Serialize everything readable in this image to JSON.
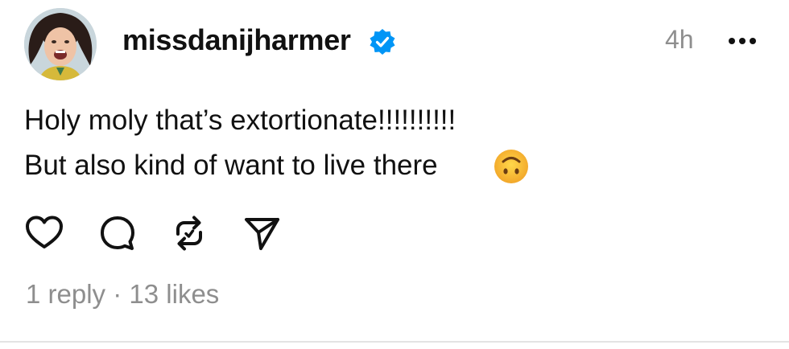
{
  "post": {
    "username": "missdanijharmer",
    "time_ago": "4h",
    "text_line1": "Holy moly that’s extortionate!!!!!!!!!!",
    "text_line2": "But also kind of want to live there",
    "emoji": "upside-down-face",
    "reply_count_label": "1 reply",
    "separator": "·",
    "like_count_label": "13 likes"
  },
  "icons": {
    "verified": "verified-badge-icon",
    "more": "more-horizontal-icon",
    "like": "heart-icon",
    "reply": "comment-icon",
    "repost": "repost-icon",
    "share": "send-icon"
  },
  "colors": {
    "verified_blue": "#0095f6",
    "secondary_text": "#8e8e8e",
    "primary_text": "#111111"
  }
}
